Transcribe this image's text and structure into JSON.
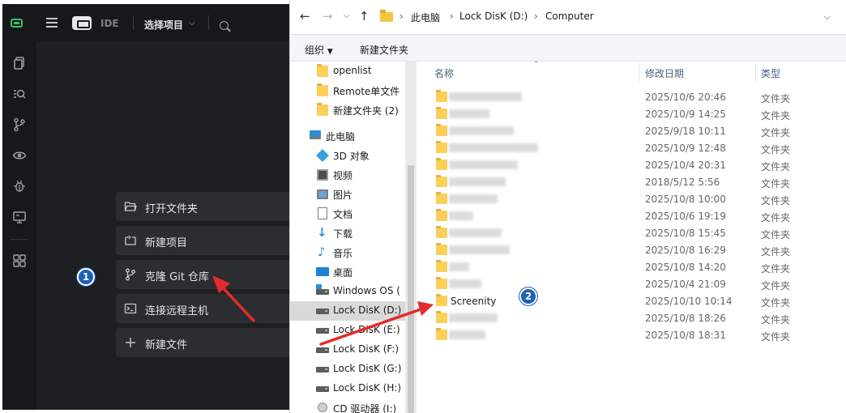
{
  "ide": {
    "topbar": {
      "ide_label": "IDE",
      "project_selector_label": "选择项目"
    },
    "activity_bar_icons": [
      "explorer-icon",
      "search-icon",
      "source-control-icon",
      "preview-icon",
      "debug-icon",
      "remote-icon",
      "extensions-icon"
    ],
    "actions": [
      {
        "label": "打开文件夹",
        "icon": "open-folder-icon"
      },
      {
        "label": "新建项目",
        "icon": "new-project-icon"
      },
      {
        "label": "克隆 Git 仓库",
        "icon": "git-branch-icon"
      },
      {
        "label": "连接远程主机",
        "icon": "terminal-icon"
      },
      {
        "label": "新建文件",
        "icon": "plus-icon"
      }
    ]
  },
  "explorer": {
    "breadcrumb": [
      "此电脑",
      "Lock DisK (D:)",
      "Computer"
    ],
    "toolbar": {
      "organize_label": "组织",
      "new_folder_label": "新建文件夹"
    },
    "nav_items": [
      {
        "label": "openlist",
        "icon": "folder-icon"
      },
      {
        "label": "Remote单文件",
        "icon": "folder-icon"
      },
      {
        "label": "新建文件夹 (2)",
        "icon": "folder-icon"
      },
      {
        "label": "此电脑",
        "icon": "this-pc-icon"
      },
      {
        "label": "3D 对象",
        "icon": "3d-objects-icon"
      },
      {
        "label": "视频",
        "icon": "videos-icon"
      },
      {
        "label": "图片",
        "icon": "pictures-icon"
      },
      {
        "label": "文档",
        "icon": "documents-icon"
      },
      {
        "label": "下载",
        "icon": "downloads-icon"
      },
      {
        "label": "音乐",
        "icon": "music-icon"
      },
      {
        "label": "桌面",
        "icon": "desktop-icon"
      },
      {
        "label": "Windows  OS (",
        "icon": "windows-drive-icon"
      },
      {
        "label": "Lock DisK (D:)",
        "icon": "drive-icon",
        "selected": true
      },
      {
        "label": "Lock DisK (E:)",
        "icon": "drive-icon"
      },
      {
        "label": "Lock DisK (F:)",
        "icon": "drive-icon"
      },
      {
        "label": "Lock DisK (G:)",
        "icon": "drive-icon"
      },
      {
        "label": "Lock DisK (H:)",
        "icon": "drive-icon"
      },
      {
        "label": "CD 驱动器 (I:)",
        "icon": "cd-drive-icon"
      }
    ],
    "columns": {
      "name": "名称",
      "modified": "修改日期",
      "type": "类型"
    },
    "files": [
      {
        "name": "",
        "modified": "2025/10/6 20:46",
        "type": "文件夹"
      },
      {
        "name": "",
        "modified": "2025/10/9 14:25",
        "type": "文件夹"
      },
      {
        "name": "",
        "modified": "2025/9/18 10:11",
        "type": "文件夹"
      },
      {
        "name": "",
        "modified": "2025/10/9 12:48",
        "type": "文件夹"
      },
      {
        "name": "",
        "modified": "2025/10/4 20:31",
        "type": "文件夹"
      },
      {
        "name": "",
        "modified": "2018/5/12 5:56",
        "type": "文件夹"
      },
      {
        "name": "",
        "modified": "2025/10/8 10:00",
        "type": "文件夹"
      },
      {
        "name": "",
        "modified": "2025/10/6 19:19",
        "type": "文件夹"
      },
      {
        "name": "",
        "modified": "2025/10/8 15:45",
        "type": "文件夹"
      },
      {
        "name": "",
        "modified": "2025/10/8 16:29",
        "type": "文件夹"
      },
      {
        "name": "",
        "modified": "2025/10/8 14:20",
        "type": "文件夹"
      },
      {
        "name": "",
        "modified": "2025/10/4 21:09",
        "type": "文件夹"
      },
      {
        "name": "Screenity",
        "modified": "2025/10/10 10:14",
        "type": "文件夹"
      },
      {
        "name": "",
        "modified": "2025/10/8 18:26",
        "type": "文件夹"
      },
      {
        "name": "",
        "modified": "2025/10/8 18:31",
        "type": "文件夹"
      }
    ]
  },
  "annotations": {
    "step1": "1",
    "step2": "2",
    "color": "#e32b2b"
  }
}
